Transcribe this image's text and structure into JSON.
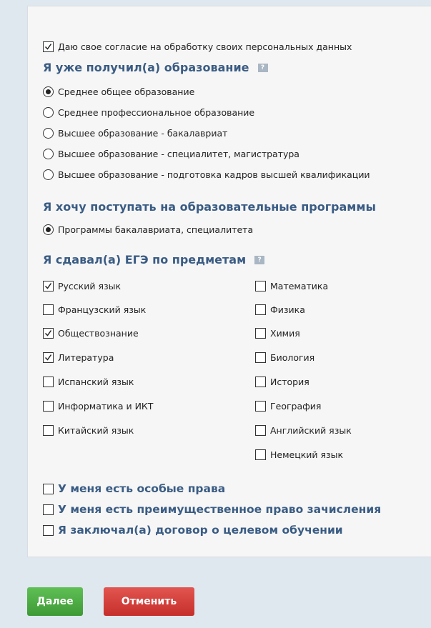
{
  "consent": {
    "label": "Даю свое согласие на обработку своих персональных данных",
    "checked": true
  },
  "education": {
    "heading": "Я уже получил(а) образование",
    "help_icon": "?",
    "options": [
      {
        "label": "Среднее общее образование",
        "selected": true
      },
      {
        "label": "Среднее профессиональное образование",
        "selected": false
      },
      {
        "label": "Высшее образование - бакалавриат",
        "selected": false
      },
      {
        "label": "Высшее образование - специалитет, магистратура",
        "selected": false
      },
      {
        "label": "Высшее образование - подготовка кадров высшей квалификации",
        "selected": false
      }
    ]
  },
  "programs": {
    "heading": "Я хочу поступать на образовательные программы",
    "options": [
      {
        "label": "Программы бакалавриата, специалитета",
        "selected": true
      }
    ]
  },
  "exams": {
    "heading": "Я сдавал(а) ЕГЭ по предметам",
    "help_icon": "?",
    "left": [
      {
        "label": "Русский язык",
        "checked": true
      },
      {
        "label": "Французский язык",
        "checked": false
      },
      {
        "label": "Обществознание",
        "checked": true
      },
      {
        "label": "Литература",
        "checked": true
      },
      {
        "label": "Испанский язык",
        "checked": false
      },
      {
        "label": "Информатика и ИКТ",
        "checked": false
      },
      {
        "label": "Китайский язык",
        "checked": false
      }
    ],
    "right": [
      {
        "label": "Математика",
        "checked": false
      },
      {
        "label": "Физика",
        "checked": false
      },
      {
        "label": "Химия",
        "checked": false
      },
      {
        "label": "Биология",
        "checked": false
      },
      {
        "label": "История",
        "checked": false
      },
      {
        "label": "География",
        "checked": false
      },
      {
        "label": "Английский язык",
        "checked": false
      },
      {
        "label": "Немецкий язык",
        "checked": false
      }
    ]
  },
  "special": [
    {
      "label": "У меня есть особые права",
      "checked": false
    },
    {
      "label": "У меня есть преимущественное право зачисления",
      "checked": false
    },
    {
      "label": "Я заключал(а) договор о целевом обучении",
      "checked": false
    }
  ],
  "buttons": {
    "next": "Далее",
    "cancel": "Отменить"
  },
  "colors": {
    "heading": "#3a5c84",
    "next": "#4cae43",
    "cancel": "#d9423e",
    "background": "#dfe7ef",
    "panel": "#f6f6f6"
  }
}
